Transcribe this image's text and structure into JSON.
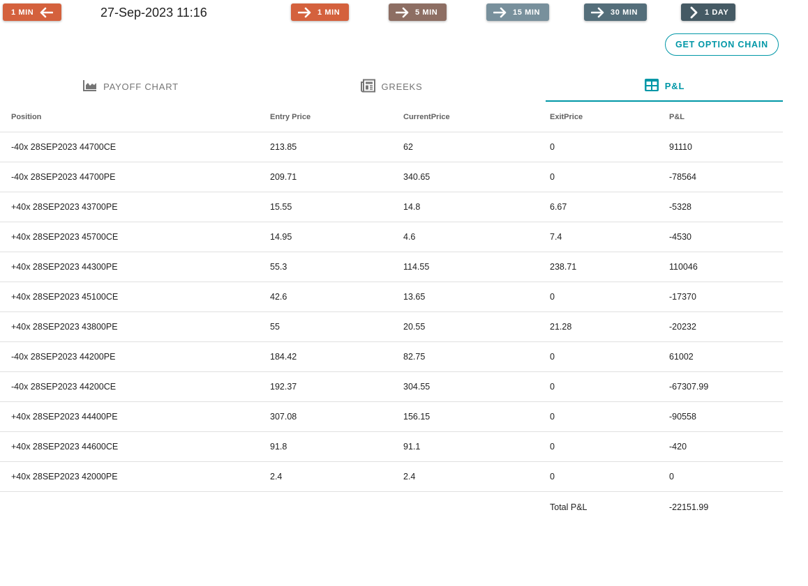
{
  "toolbar": {
    "back_button": {
      "label": "1 MIN",
      "color": "#d4613d",
      "icon": "arrow-left-icon"
    },
    "datetime": "27-Sep-2023 11:16",
    "forward_buttons": [
      {
        "label": "1 MIN",
        "color": "#d4613d",
        "icon": "arrow-right-icon"
      },
      {
        "label": "5 MIN",
        "color": "#8d6e63",
        "icon": "arrow-right-icon"
      },
      {
        "label": "15 MIN",
        "color": "#78909c",
        "icon": "arrow-right-icon"
      },
      {
        "label": "30 MIN",
        "color": "#546e7a",
        "icon": "arrow-right-icon"
      },
      {
        "label": "1 DAY",
        "color": "#455a64",
        "icon": "chevron-right-icon"
      }
    ],
    "option_chain_label": "GET OPTION CHAIN"
  },
  "tabs": [
    {
      "label": "PAYOFF CHART",
      "icon": "area-chart-icon",
      "active": false
    },
    {
      "label": "GREEKS",
      "icon": "newspaper-icon",
      "active": false
    },
    {
      "label": "P&L",
      "icon": "table-icon",
      "active": true
    }
  ],
  "accent_color": "#0097a7",
  "table": {
    "headers": [
      "Position",
      "Entry Price",
      "CurrentPrice",
      "ExitPrice",
      "P&L"
    ],
    "rows": [
      [
        "-40x 28SEP2023 44700CE",
        "213.85",
        "62",
        "0",
        "91110"
      ],
      [
        "-40x 28SEP2023 44700PE",
        "209.71",
        "340.65",
        "0",
        "-78564"
      ],
      [
        "+40x 28SEP2023 43700PE",
        "15.55",
        "14.8",
        "6.67",
        "-5328"
      ],
      [
        "+40x 28SEP2023 45700CE",
        "14.95",
        "4.6",
        "7.4",
        "-4530"
      ],
      [
        "+40x 28SEP2023 44300PE",
        "55.3",
        "114.55",
        "238.71",
        "110046"
      ],
      [
        "+40x 28SEP2023 45100CE",
        "42.6",
        "13.65",
        "0",
        "-17370"
      ],
      [
        "+40x 28SEP2023 43800PE",
        "55",
        "20.55",
        "21.28",
        "-20232"
      ],
      [
        "-40x 28SEP2023 44200PE",
        "184.42",
        "82.75",
        "0",
        "61002"
      ],
      [
        "-40x 28SEP2023 44200CE",
        "192.37",
        "304.55",
        "0",
        "-67307.99"
      ],
      [
        "+40x 28SEP2023 44400PE",
        "307.08",
        "156.15",
        "0",
        "-90558"
      ],
      [
        "+40x 28SEP2023 44600CE",
        "91.8",
        "91.1",
        "0",
        "-420"
      ],
      [
        "+40x 28SEP2023 42000PE",
        "2.4",
        "2.4",
        "0",
        "0"
      ]
    ],
    "total_label": "Total P&L",
    "total_value": "-22151.99"
  }
}
